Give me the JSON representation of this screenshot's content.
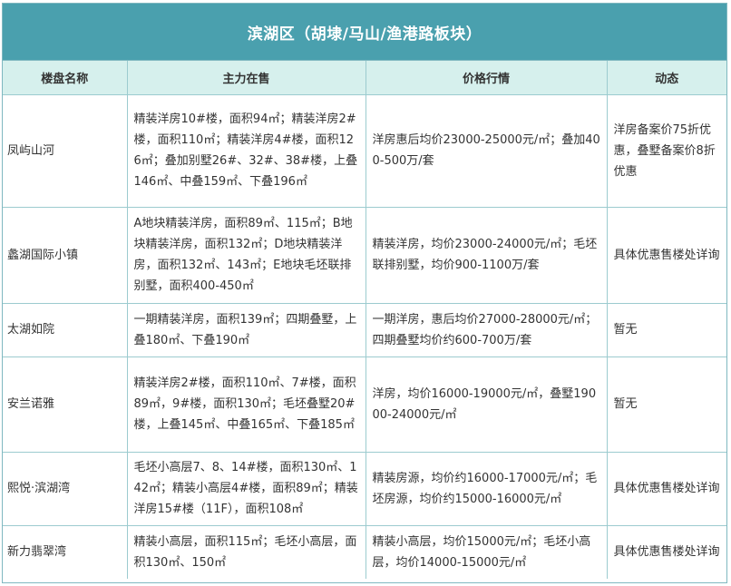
{
  "title": "滨湖区（胡埭/马山/渔港路板块）",
  "columns": [
    "楼盘名称",
    "主力在售",
    "价格行情",
    "动态"
  ],
  "rows": [
    {
      "name": "凤屿山河",
      "supply": "精装洋房10#楼，面积94㎡；精装洋房2#楼，面积110㎡；精装洋房4#楼，面积126㎡；叠加别墅26#、32#、38#楼，上叠146㎡、中叠159㎡、下叠196㎡",
      "price": "洋房惠后均价23000-25000元/㎡；叠加400-500万/套",
      "news": "洋房备案价75折优惠，叠墅备案价8折优惠"
    },
    {
      "name": "蠡湖国际小镇",
      "supply": "A地块精装洋房，面积89㎡、115㎡；B地块精装洋房，面积132㎡；D地块精装洋房，面积132㎡、143㎡；E地块毛坯联排别墅，面积400-450㎡",
      "price": "精装洋房，均价23000-24000元/㎡；毛坯联排别墅，均价900-1100万/套",
      "news": "具体优惠售楼处详询"
    },
    {
      "name": "太湖如院",
      "supply": "一期精装洋房，面积139㎡；四期叠墅，上叠180㎡、下叠190㎡",
      "price": "一期洋房，惠后均价27000-28000元/㎡；四期叠墅均价约600-700万/套",
      "news": "暂无"
    },
    {
      "name": "安兰诺雅",
      "supply": "精装洋房2#楼，面积110㎡、7#楼，面积89㎡，9#楼，面积130㎡；毛坯叠墅20#楼，上叠145㎡、中叠165㎡、下叠185㎡",
      "price": "洋房，均价16000-19000元/㎡，叠墅19000-24000元/㎡",
      "news": "暂无"
    },
    {
      "name": "熙悦·滨湖湾",
      "supply": "毛坯小高层7、8、14#楼，面积130㎡、142㎡；精装小高层4#楼，面积89㎡；精装洋房15#楼（11F），面积108㎡",
      "price": "精装房源，均价约16000-17000元/㎡；毛坯房源，均价约15000-16000元/㎡",
      "news": "具体优惠售楼处详询"
    },
    {
      "name": "新力翡翠湾",
      "supply": "精装小高层，面积115㎡；毛坯小高层，面积130㎡、150㎡",
      "price": "精装小高层，均价15000元/㎡；毛坯小高层，均价14000-15000元/㎡",
      "news": "具体优惠售楼处详询"
    }
  ]
}
